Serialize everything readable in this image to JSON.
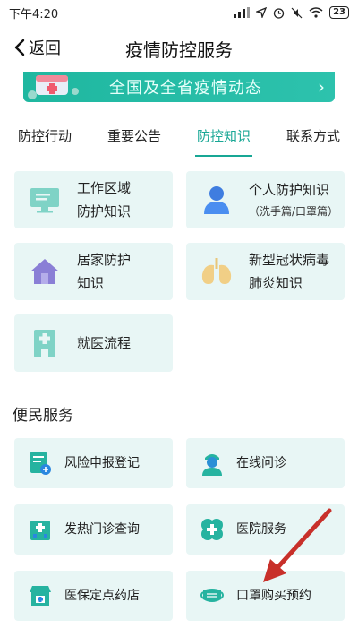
{
  "status_bar": {
    "time": "下午4:20",
    "battery": "23"
  },
  "nav": {
    "back_label": "返回",
    "title": "疫情防控服务"
  },
  "banner": {
    "text": "全国及全省疫情动态",
    "arrow": "›"
  },
  "tabs": [
    {
      "label": "防控行动"
    },
    {
      "label": "重要公告"
    },
    {
      "label": "防控知识"
    },
    {
      "label": "联系方式"
    }
  ],
  "knowledge_cards": [
    {
      "line1": "工作区域",
      "line2": "防护知识",
      "icon": "monitor-icon"
    },
    {
      "line1": "个人防护知识",
      "line2": "（洗手篇/口罩篇）",
      "icon": "person-icon"
    },
    {
      "line1": "居家防护",
      "line2": "知识",
      "icon": "house-icon"
    },
    {
      "line1": "新型冠状病毒",
      "line2": "肺炎知识",
      "icon": "lungs-icon"
    },
    {
      "line1": "就医流程",
      "icon": "hospital-icon"
    }
  ],
  "services": {
    "title": "便民服务",
    "items": [
      {
        "label": "风险申报登记",
        "icon": "document-icon"
      },
      {
        "label": "在线问诊",
        "icon": "doctor-icon"
      },
      {
        "label": "发热门诊查询",
        "icon": "clinic-icon"
      },
      {
        "label": "医院服务",
        "icon": "medical-cross-icon"
      },
      {
        "label": "医保定点药店",
        "icon": "pharmacy-icon"
      },
      {
        "label": "口罩购买预约",
        "icon": "mask-icon"
      }
    ]
  },
  "colors": {
    "accent": "#18a795",
    "card_bg": "#e8f6f5",
    "banner": "#22b9a3",
    "arrow_red": "#c8302a"
  }
}
